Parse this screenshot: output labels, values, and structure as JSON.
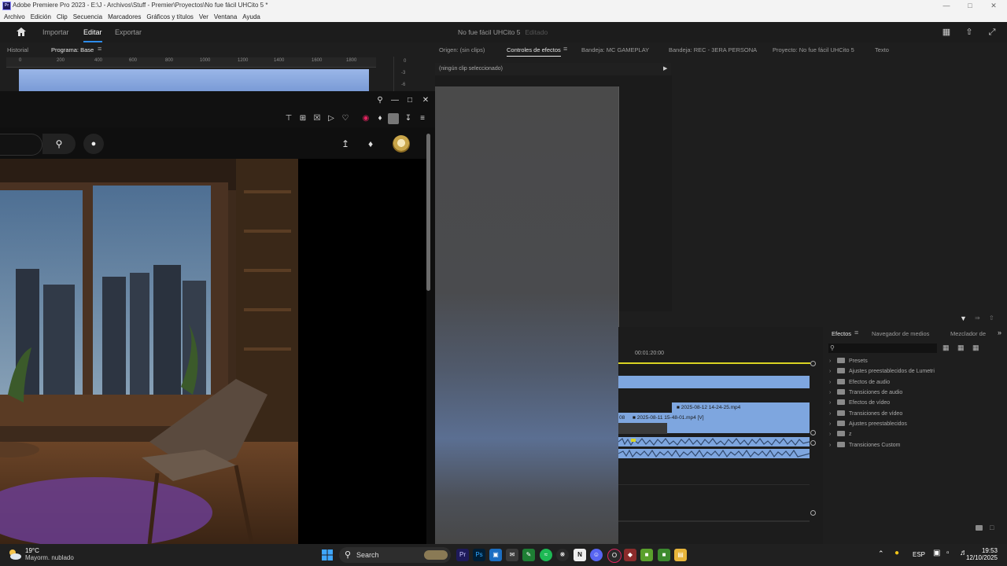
{
  "window": {
    "title": "Adobe Premiere Pro 2023 - E:\\J - Archivos\\Stuff - Premier\\Proyectos\\No fue fácil UHCito 5 *",
    "app_icon": "Pr",
    "controls": [
      "minimize-icon",
      "maximize-icon",
      "close-icon"
    ]
  },
  "menu": [
    "Archivo",
    "Edición",
    "Clip",
    "Secuencia",
    "Marcadores",
    "Gráficos y títulos",
    "Ver",
    "Ventana",
    "Ayuda"
  ],
  "header": {
    "tabs": [
      "Importar",
      "Editar",
      "Exportar"
    ],
    "active_tab": "Editar",
    "project": "No fue fácil UHCito 5",
    "status": "Editado"
  },
  "program_panel": {
    "tabs": [
      "Historial",
      "Programa: Base"
    ],
    "ruler_labels": [
      "0",
      "200",
      "400",
      "600",
      "800",
      "1000",
      "1200",
      "1400",
      "1600",
      "1800"
    ],
    "meter_labels": [
      "0",
      "-3",
      "-6"
    ]
  },
  "effect_controls": {
    "tabs": [
      "Origen: (sin clips)",
      "Controles de efectos",
      "Bandeja: MC GAMEPLAY",
      "Bandeja: REC - 3ERA PERSONA",
      "Proyecto: No fue fácil UHCito 5",
      "Texto"
    ],
    "no_clip": "(ningún clip seleccionado)"
  },
  "timeline": {
    "timecode": "00:01:20:00",
    "clips": [
      "2025-08-12 14-24-25.mp4",
      "2025-08-11 15-48-01.mp4 [V]",
      "08"
    ]
  },
  "effects_panel": {
    "tabs": [
      "Efectos",
      "Navegador de medios",
      "Mezclador de"
    ],
    "items": [
      "Presets",
      "Ajustes preestablecidos de Lumetri",
      "Efectos de audio",
      "Transiciones de audio",
      "Efectos de vídeo",
      "Transiciones de vídeo",
      "Ajustes preestablecidos",
      "z",
      "Transiciones Custom"
    ]
  },
  "taskbar": {
    "temperature": "19°C",
    "weather": "Mayorm. nublado",
    "search": "Search",
    "language": "ESP",
    "time": "19:53",
    "date": "12/10/2025"
  },
  "colors": {
    "accent": "#2d8ceb",
    "clip_blue": "#7ea6df",
    "playhead_yellow": "#d9d323",
    "youtube_red": "#e0245e"
  }
}
